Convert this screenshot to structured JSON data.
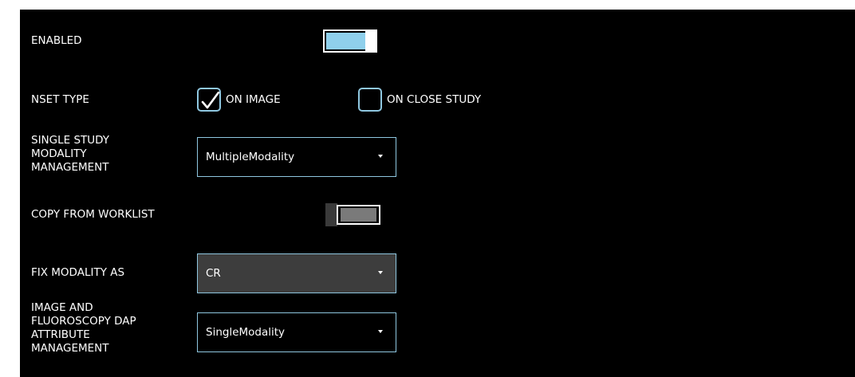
{
  "settings": {
    "enabled": {
      "label": "ENABLED",
      "on": true
    },
    "nset_type": {
      "label": "NSET TYPE",
      "options": [
        {
          "label": "ON IMAGE",
          "checked": true
        },
        {
          "label": "ON CLOSE STUDY",
          "checked": false
        }
      ]
    },
    "single_study_modality": {
      "label_lines": [
        "SINGLE STUDY",
        "MODALITY",
        "MANAGEMENT"
      ],
      "value": "MultipleModality"
    },
    "copy_from_worklist": {
      "label": "COPY FROM WORKLIST",
      "on": false
    },
    "fix_modality": {
      "label": "FIX MODALITY AS",
      "value": "CR"
    },
    "dap_attribute": {
      "label_lines": [
        "IMAGE AND",
        "FLUOROSCOPY DAP",
        "ATTRIBUTE",
        "MANAGEMENT"
      ],
      "value": "SingleModality"
    }
  },
  "colors": {
    "background": "#000000",
    "accent": "#8fc7e0",
    "toggle_on_fill": "#8fd0ec",
    "toggle_off_fill": "#7a7a7a",
    "combo_disabled_bg": "#3d3d3d"
  },
  "icons": {
    "check": "checkmark-icon",
    "dropdown": "chevron-down-icon"
  }
}
